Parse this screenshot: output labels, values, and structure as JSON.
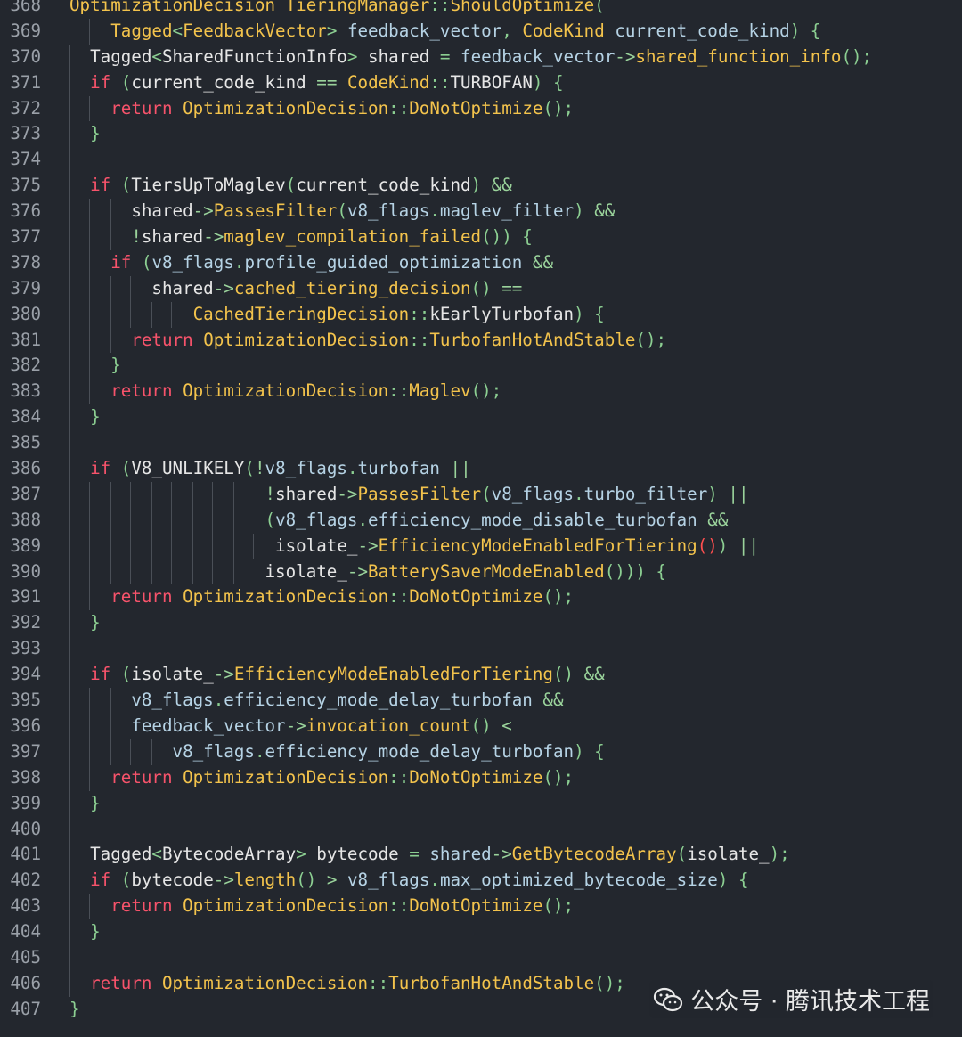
{
  "watermark": {
    "text": "公众号 · 腾讯技术工程",
    "icon": "wechat-icon"
  },
  "colors": {
    "background": "#23272e",
    "keyword": "#f7536b",
    "type": "#f3c34c",
    "text": "#e6e6e6",
    "line_number": "#9aa0a8"
  },
  "lines": [
    {
      "n": "368",
      "guides": [],
      "tokens": [
        [
          "ty",
          "OptimizationDecision"
        ],
        [
          "pl",
          " "
        ],
        [
          "ty",
          "TieringManager"
        ],
        [
          "pu",
          "::"
        ],
        [
          "fn",
          "ShouldOptimize"
        ],
        [
          "pu",
          "("
        ]
      ]
    },
    {
      "n": "369",
      "guides": [
        100
      ],
      "tokens": [
        [
          "pl",
          "    "
        ],
        [
          "ty",
          "Tagged"
        ],
        [
          "pu",
          "<"
        ],
        [
          "ty",
          "FeedbackVector"
        ],
        [
          "pu",
          "> "
        ],
        [
          "va",
          "feedback_vector"
        ],
        [
          "pu",
          ", "
        ],
        [
          "ty",
          "CodeKind"
        ],
        [
          "pl",
          " "
        ],
        [
          "va",
          "current_code_kind"
        ],
        [
          "pu",
          ") {"
        ]
      ]
    },
    {
      "n": "370",
      "guides": [
        78
      ],
      "tokens": [
        [
          "pl",
          "  Tagged"
        ],
        [
          "pu",
          "<"
        ],
        [
          "pl",
          "SharedFunctionInfo"
        ],
        [
          "pu",
          "> "
        ],
        [
          "pl",
          "shared "
        ],
        [
          "pu",
          "= "
        ],
        [
          "va",
          "feedback_vector"
        ],
        [
          "op",
          "->"
        ],
        [
          "fn",
          "shared_function_info"
        ],
        [
          "pu",
          "();"
        ]
      ]
    },
    {
      "n": "371",
      "guides": [
        78
      ],
      "tokens": [
        [
          "pl",
          "  "
        ],
        [
          "kw",
          "if"
        ],
        [
          "pl",
          " "
        ],
        [
          "pu",
          "("
        ],
        [
          "mb",
          "current_code_kind"
        ],
        [
          "pl",
          " "
        ],
        [
          "op",
          "=="
        ],
        [
          "pl",
          " "
        ],
        [
          "ty",
          "CodeKind"
        ],
        [
          "pu",
          "::"
        ],
        [
          "pl",
          "TURBOFAN"
        ],
        [
          "pu",
          ") {"
        ]
      ]
    },
    {
      "n": "372",
      "guides": [
        78,
        100
      ],
      "tokens": [
        [
          "pl",
          "    "
        ],
        [
          "kw",
          "return"
        ],
        [
          "pl",
          " "
        ],
        [
          "ty",
          "OptimizationDecision"
        ],
        [
          "pu",
          "::"
        ],
        [
          "fn",
          "DoNotOptimize"
        ],
        [
          "pu",
          "();"
        ]
      ]
    },
    {
      "n": "373",
      "guides": [
        78
      ],
      "tokens": [
        [
          "pl",
          "  "
        ],
        [
          "pu",
          "}"
        ]
      ]
    },
    {
      "n": "374",
      "guides": [
        78
      ],
      "tokens": []
    },
    {
      "n": "375",
      "guides": [
        78
      ],
      "tokens": [
        [
          "pl",
          "  "
        ],
        [
          "kw",
          "if"
        ],
        [
          "pl",
          " "
        ],
        [
          "pu",
          "("
        ],
        [
          "pl",
          "TiersUpToMaglev"
        ],
        [
          "pu",
          "("
        ],
        [
          "mb",
          "current_code_kind"
        ],
        [
          "pu",
          ") "
        ],
        [
          "op",
          "&&"
        ]
      ]
    },
    {
      "n": "376",
      "guides": [
        78,
        100,
        124
      ],
      "tokens": [
        [
          "pl",
          "      "
        ],
        [
          "pl",
          "shared"
        ],
        [
          "op",
          "->"
        ],
        [
          "fn",
          "PassesFilter"
        ],
        [
          "pu",
          "("
        ],
        [
          "va",
          "v8_flags"
        ],
        [
          "pu",
          "."
        ],
        [
          "va",
          "maglev_filter"
        ],
        [
          "pu",
          ") "
        ],
        [
          "op",
          "&&"
        ]
      ]
    },
    {
      "n": "377",
      "guides": [
        78,
        100,
        124
      ],
      "tokens": [
        [
          "pl",
          "      "
        ],
        [
          "op",
          "!"
        ],
        [
          "pl",
          "shared"
        ],
        [
          "op",
          "->"
        ],
        [
          "fn",
          "maglev_compilation_failed"
        ],
        [
          "pu",
          "()) {"
        ]
      ]
    },
    {
      "n": "378",
      "guides": [
        78,
        100
      ],
      "tokens": [
        [
          "pl",
          "    "
        ],
        [
          "kw",
          "if"
        ],
        [
          "pl",
          " "
        ],
        [
          "pu",
          "("
        ],
        [
          "va",
          "v8_flags"
        ],
        [
          "pu",
          "."
        ],
        [
          "va",
          "profile_guided_optimization"
        ],
        [
          "pl",
          " "
        ],
        [
          "op",
          "&&"
        ]
      ]
    },
    {
      "n": "379",
      "guides": [
        78,
        100,
        124,
        146
      ],
      "tokens": [
        [
          "pl",
          "        "
        ],
        [
          "pl",
          "shared"
        ],
        [
          "op",
          "->"
        ],
        [
          "fn",
          "cached_tiering_decision"
        ],
        [
          "pu",
          "() "
        ],
        [
          "op",
          "=="
        ]
      ]
    },
    {
      "n": "380",
      "guides": [
        78,
        100,
        124,
        146,
        170,
        192
      ],
      "tokens": [
        [
          "pl",
          "            "
        ],
        [
          "ty",
          "CachedTieringDecision"
        ],
        [
          "pu",
          "::"
        ],
        [
          "pl",
          "kEarlyTurbofan"
        ],
        [
          "pu",
          ") {"
        ]
      ]
    },
    {
      "n": "381",
      "guides": [
        78,
        100,
        124
      ],
      "tokens": [
        [
          "pl",
          "      "
        ],
        [
          "kw",
          "return"
        ],
        [
          "pl",
          " "
        ],
        [
          "ty",
          "OptimizationDecision"
        ],
        [
          "pu",
          "::"
        ],
        [
          "fn",
          "TurbofanHotAndStable"
        ],
        [
          "pu",
          "();"
        ]
      ]
    },
    {
      "n": "382",
      "guides": [
        78,
        100
      ],
      "tokens": [
        [
          "pl",
          "    "
        ],
        [
          "pu",
          "}"
        ]
      ]
    },
    {
      "n": "383",
      "guides": [
        78,
        100
      ],
      "tokens": [
        [
          "pl",
          "    "
        ],
        [
          "kw",
          "return"
        ],
        [
          "pl",
          " "
        ],
        [
          "ty",
          "OptimizationDecision"
        ],
        [
          "pu",
          "::"
        ],
        [
          "fn",
          "Maglev"
        ],
        [
          "pu",
          "();"
        ]
      ]
    },
    {
      "n": "384",
      "guides": [
        78
      ],
      "tokens": [
        [
          "pl",
          "  "
        ],
        [
          "pu",
          "}"
        ]
      ]
    },
    {
      "n": "385",
      "guides": [
        78
      ],
      "tokens": []
    },
    {
      "n": "386",
      "guides": [
        78
      ],
      "tokens": [
        [
          "pl",
          "  "
        ],
        [
          "kw",
          "if"
        ],
        [
          "pl",
          " "
        ],
        [
          "pu",
          "("
        ],
        [
          "pl",
          "V8_UNLIKELY"
        ],
        [
          "pu",
          "("
        ],
        [
          "op",
          "!"
        ],
        [
          "va",
          "v8_flags"
        ],
        [
          "pu",
          "."
        ],
        [
          "va",
          "turbofan"
        ],
        [
          "pl",
          " "
        ],
        [
          "op",
          "||"
        ]
      ]
    },
    {
      "n": "387",
      "guides": [
        78,
        100,
        124,
        146,
        170,
        192,
        216,
        238,
        262
      ],
      "tokens": [
        [
          "pl",
          "                   "
        ],
        [
          "op",
          "!"
        ],
        [
          "pl",
          "shared"
        ],
        [
          "op",
          "->"
        ],
        [
          "fn",
          "PassesFilter"
        ],
        [
          "pu",
          "("
        ],
        [
          "va",
          "v8_flags"
        ],
        [
          "pu",
          "."
        ],
        [
          "va",
          "turbo_filter"
        ],
        [
          "pu",
          ") "
        ],
        [
          "op",
          "||"
        ]
      ]
    },
    {
      "n": "388",
      "guides": [
        78,
        100,
        124,
        146,
        170,
        192,
        216,
        238,
        262
      ],
      "tokens": [
        [
          "pl",
          "                   "
        ],
        [
          "pu",
          "("
        ],
        [
          "va",
          "v8_flags"
        ],
        [
          "pu",
          "."
        ],
        [
          "va",
          "efficiency_mode_disable_turbofan"
        ],
        [
          "pl",
          " "
        ],
        [
          "op",
          "&&"
        ]
      ]
    },
    {
      "n": "389",
      "guides": [
        78,
        100,
        124,
        146,
        170,
        192,
        216,
        238,
        262,
        284
      ],
      "tokens": [
        [
          "pl",
          "                    "
        ],
        [
          "pl",
          "isolate_"
        ],
        [
          "op",
          "->"
        ],
        [
          "fn",
          "EfficiencyModeEnabledForTiering"
        ],
        [
          "bad",
          "()"
        ],
        [
          "pu",
          ") "
        ],
        [
          "op",
          "||"
        ]
      ]
    },
    {
      "n": "390",
      "guides": [
        78,
        100,
        124,
        146,
        170,
        192,
        216,
        238,
        262
      ],
      "tokens": [
        [
          "pl",
          "                   "
        ],
        [
          "pl",
          "isolate_"
        ],
        [
          "op",
          "->"
        ],
        [
          "fn",
          "BatterySaverModeEnabled"
        ],
        [
          "pu",
          "())) {"
        ]
      ]
    },
    {
      "n": "391",
      "guides": [
        78,
        100
      ],
      "tokens": [
        [
          "pl",
          "    "
        ],
        [
          "kw",
          "return"
        ],
        [
          "pl",
          " "
        ],
        [
          "ty",
          "OptimizationDecision"
        ],
        [
          "pu",
          "::"
        ],
        [
          "fn",
          "DoNotOptimize"
        ],
        [
          "pu",
          "();"
        ]
      ]
    },
    {
      "n": "392",
      "guides": [
        78
      ],
      "tokens": [
        [
          "pl",
          "  "
        ],
        [
          "pu",
          "}"
        ]
      ]
    },
    {
      "n": "393",
      "guides": [
        78
      ],
      "tokens": []
    },
    {
      "n": "394",
      "guides": [
        78
      ],
      "tokens": [
        [
          "pl",
          "  "
        ],
        [
          "kw",
          "if"
        ],
        [
          "pl",
          " "
        ],
        [
          "pu",
          "("
        ],
        [
          "pl",
          "isolate_"
        ],
        [
          "op",
          "->"
        ],
        [
          "fn",
          "EfficiencyModeEnabledForTiering"
        ],
        [
          "pu",
          "() "
        ],
        [
          "op",
          "&&"
        ]
      ]
    },
    {
      "n": "395",
      "guides": [
        78,
        100,
        124
      ],
      "tokens": [
        [
          "pl",
          "      "
        ],
        [
          "va",
          "v8_flags"
        ],
        [
          "pu",
          "."
        ],
        [
          "va",
          "efficiency_mode_delay_turbofan"
        ],
        [
          "pl",
          " "
        ],
        [
          "op",
          "&&"
        ]
      ]
    },
    {
      "n": "396",
      "guides": [
        78,
        100,
        124
      ],
      "tokens": [
        [
          "pl",
          "      "
        ],
        [
          "va",
          "feedback_vector"
        ],
        [
          "op",
          "->"
        ],
        [
          "fn",
          "invocation_count"
        ],
        [
          "pu",
          "() "
        ],
        [
          "op",
          "<"
        ]
      ]
    },
    {
      "n": "397",
      "guides": [
        78,
        100,
        124,
        146,
        170
      ],
      "tokens": [
        [
          "pl",
          "          "
        ],
        [
          "va",
          "v8_flags"
        ],
        [
          "pu",
          "."
        ],
        [
          "va",
          "efficiency_mode_delay_turbofan"
        ],
        [
          "pu",
          ") {"
        ]
      ]
    },
    {
      "n": "398",
      "guides": [
        78,
        100
      ],
      "tokens": [
        [
          "pl",
          "    "
        ],
        [
          "kw",
          "return"
        ],
        [
          "pl",
          " "
        ],
        [
          "ty",
          "OptimizationDecision"
        ],
        [
          "pu",
          "::"
        ],
        [
          "fn",
          "DoNotOptimize"
        ],
        [
          "pu",
          "();"
        ]
      ]
    },
    {
      "n": "399",
      "guides": [
        78
      ],
      "tokens": [
        [
          "pl",
          "  "
        ],
        [
          "pu",
          "}"
        ]
      ]
    },
    {
      "n": "400",
      "guides": [
        78
      ],
      "tokens": []
    },
    {
      "n": "401",
      "guides": [
        78
      ],
      "tokens": [
        [
          "pl",
          "  Tagged"
        ],
        [
          "pu",
          "<"
        ],
        [
          "pl",
          "BytecodeArray"
        ],
        [
          "pu",
          "> "
        ],
        [
          "pl",
          "bytecode "
        ],
        [
          "pu",
          "= "
        ],
        [
          "va",
          "shared"
        ],
        [
          "op",
          "->"
        ],
        [
          "fn",
          "GetBytecodeArray"
        ],
        [
          "pu",
          "("
        ],
        [
          "pl",
          "isolate_"
        ],
        [
          "pu",
          ");"
        ]
      ]
    },
    {
      "n": "402",
      "guides": [
        78
      ],
      "tokens": [
        [
          "pl",
          "  "
        ],
        [
          "kw",
          "if"
        ],
        [
          "pl",
          " "
        ],
        [
          "pu",
          "("
        ],
        [
          "pl",
          "bytecode"
        ],
        [
          "op",
          "->"
        ],
        [
          "fn",
          "length"
        ],
        [
          "pu",
          "() "
        ],
        [
          "op",
          ">"
        ],
        [
          "pl",
          " "
        ],
        [
          "va",
          "v8_flags"
        ],
        [
          "pu",
          "."
        ],
        [
          "va",
          "max_optimized_bytecode_size"
        ],
        [
          "pu",
          ") {"
        ]
      ]
    },
    {
      "n": "403",
      "guides": [
        78,
        100
      ],
      "tokens": [
        [
          "pl",
          "    "
        ],
        [
          "kw",
          "return"
        ],
        [
          "pl",
          " "
        ],
        [
          "ty",
          "OptimizationDecision"
        ],
        [
          "pu",
          "::"
        ],
        [
          "fn",
          "DoNotOptimize"
        ],
        [
          "pu",
          "();"
        ]
      ]
    },
    {
      "n": "404",
      "guides": [
        78
      ],
      "tokens": [
        [
          "pl",
          "  "
        ],
        [
          "pu",
          "}"
        ]
      ]
    },
    {
      "n": "405",
      "guides": [
        78
      ],
      "tokens": []
    },
    {
      "n": "406",
      "guides": [
        78
      ],
      "tokens": [
        [
          "pl",
          "  "
        ],
        [
          "kw",
          "return"
        ],
        [
          "pl",
          " "
        ],
        [
          "ty",
          "OptimizationDecision"
        ],
        [
          "pu",
          "::"
        ],
        [
          "fn",
          "TurbofanHotAndStable"
        ],
        [
          "pu",
          "();"
        ]
      ]
    },
    {
      "n": "407",
      "guides": [],
      "tokens": [
        [
          "pu",
          "}"
        ]
      ]
    }
  ]
}
